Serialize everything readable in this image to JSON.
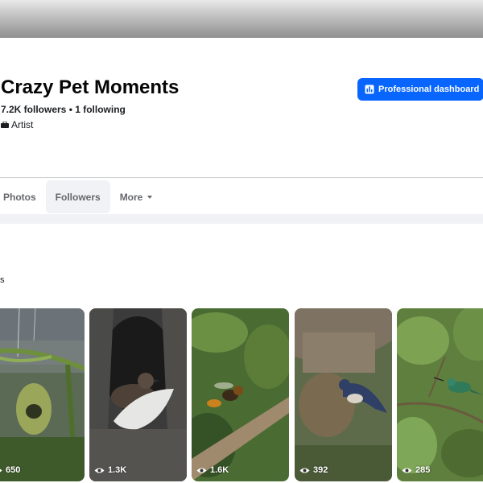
{
  "page": {
    "title": "Crazy Pet Moments",
    "stats": "7.2K followers • 1 following",
    "category": "Artist"
  },
  "actions": {
    "professional_dashboard": "Professional dashboard"
  },
  "tabs": [
    {
      "label": "Photos"
    },
    {
      "label": "Followers"
    },
    {
      "label": "More"
    }
  ],
  "section": {
    "partial_label": "s"
  },
  "reels": [
    {
      "subject": "weaver bird nest in rain",
      "views": "650"
    },
    {
      "subject": "bird in tree hollow nest",
      "views": "1.3K"
    },
    {
      "subject": "wasp on branch",
      "views": "1.6K"
    },
    {
      "subject": "swallow at mud nest",
      "views": "392"
    },
    {
      "subject": "hummingbird on twig",
      "views": "285"
    }
  ],
  "colors": {
    "accent": "#0866ff",
    "tab_active_bg": "#f0f2f5",
    "muted_text": "#65676b"
  }
}
